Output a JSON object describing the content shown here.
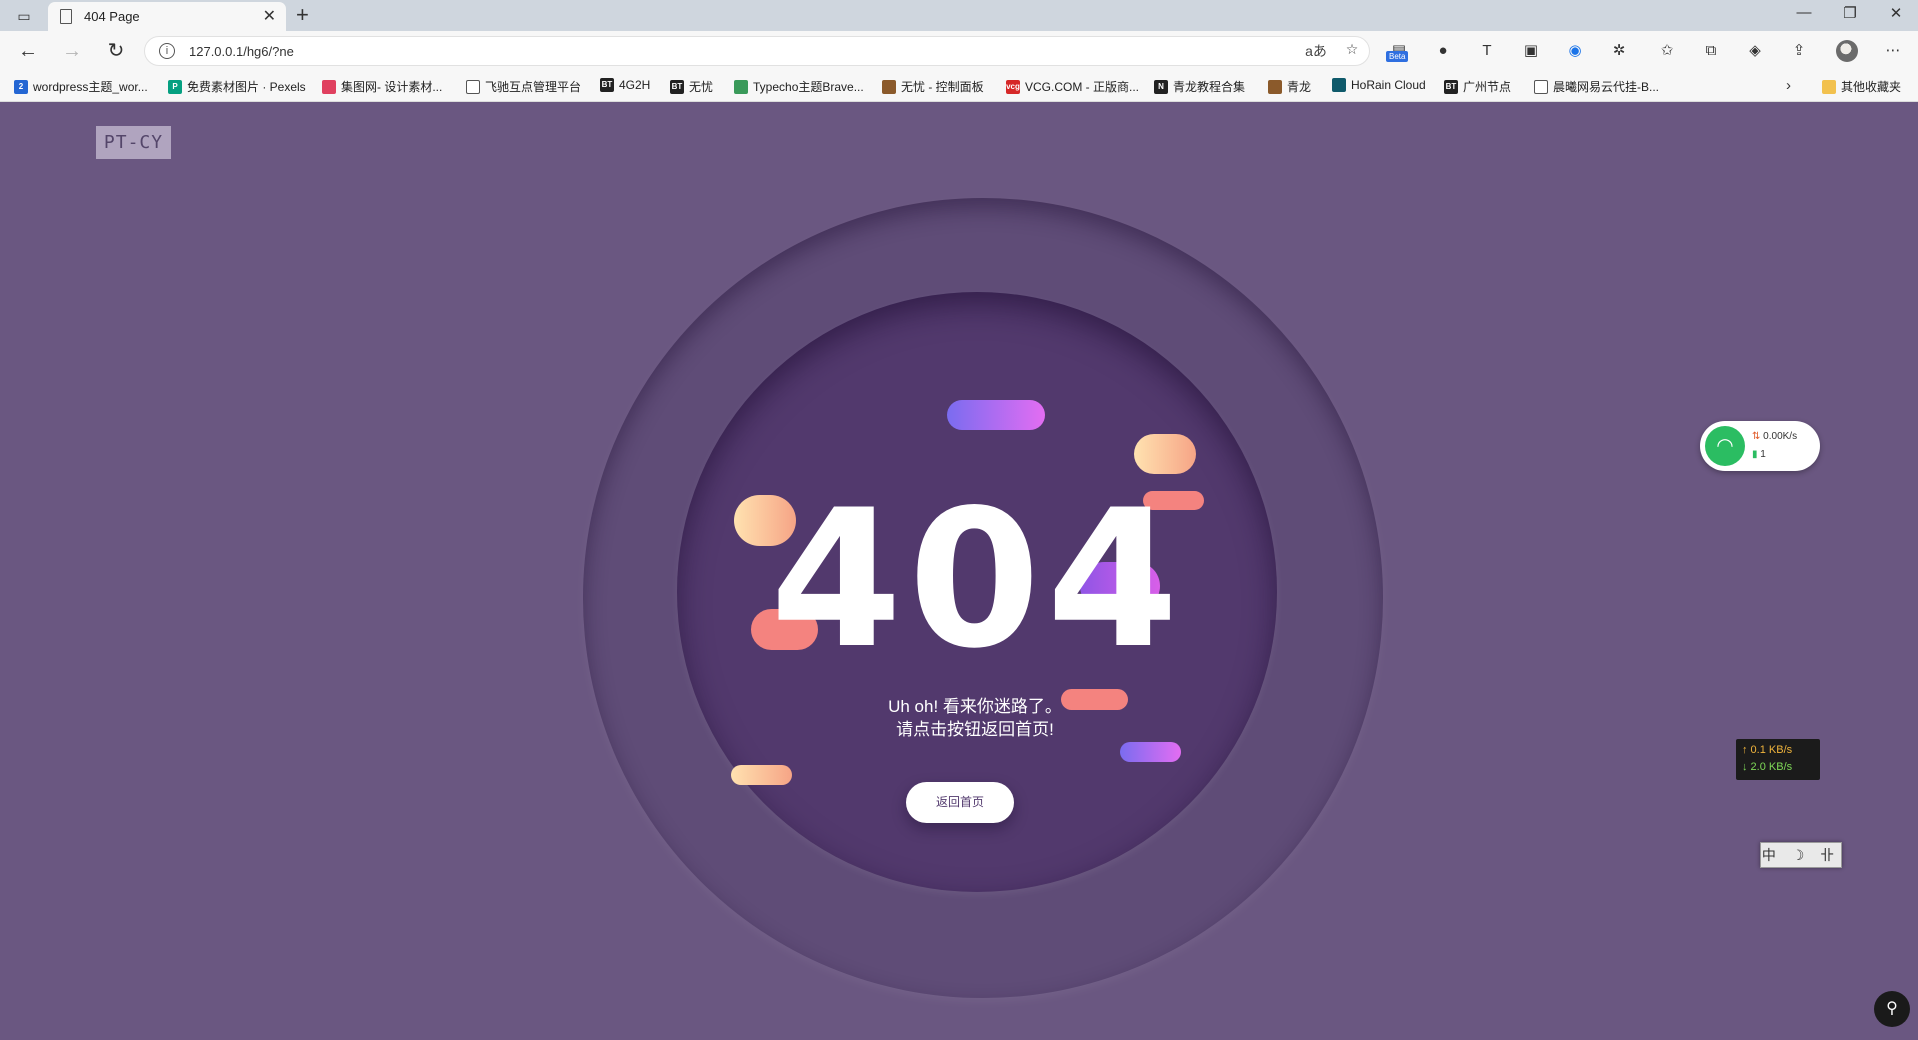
{
  "browser": {
    "tab": {
      "title": "404 Page"
    },
    "address": {
      "url": "127.0.0.1/hg6/?ne"
    },
    "beta_badge": "Beta",
    "bookmarks": [
      {
        "label": "wordpress主题_wor...",
        "icon_color": "#2466d3",
        "icon_text": "2"
      },
      {
        "label": "免费素材图片 · Pexels",
        "icon_color": "#05a081",
        "icon_text": "P"
      },
      {
        "label": "集图网- 设计素材...",
        "icon_color": "#e0405f",
        "icon_text": ""
      },
      {
        "label": "飞驰互点管理平台",
        "icon_color": "#ffffff",
        "icon_text": ""
      },
      {
        "label": "4G2H",
        "icon_color": "#222222",
        "icon_text": "BT"
      },
      {
        "label": "无忧",
        "icon_color": "#222222",
        "icon_text": "BT"
      },
      {
        "label": "Typecho主题Brave...",
        "icon_color": "#3a9a5a",
        "icon_text": ""
      },
      {
        "label": "无忧 - 控制面板",
        "icon_color": "#8b5a2b",
        "icon_text": ""
      },
      {
        "label": "VCG.COM - 正版商...",
        "icon_color": "#d62828",
        "icon_text": "vcg"
      },
      {
        "label": "青龙教程合集",
        "icon_color": "#222222",
        "icon_text": "N"
      },
      {
        "label": "青龙",
        "icon_color": "#8b5a2b",
        "icon_text": ""
      },
      {
        "label": "HoRain Cloud",
        "icon_color": "#0f5a6b",
        "icon_text": ""
      },
      {
        "label": "广州节点",
        "icon_color": "#222222",
        "icon_text": "BT"
      },
      {
        "label": "晨曦网易云代挂-B...",
        "icon_color": "#ffffff",
        "icon_text": ""
      }
    ],
    "other_bookmarks": "其他收藏夹"
  },
  "page": {
    "logo": "PT-CY",
    "error_code": "404",
    "message_line1": "Uh oh! 看来你迷路了。",
    "message_line2": "请点击按钮返回首页!",
    "home_button": "返回首页"
  },
  "widgets": {
    "net_speed": "0.00K/s",
    "net_devices": "1",
    "upload": "↑ 0.1 KB/s",
    "download": "↓ 2.0 KB/s",
    "ime": "中 ☽ 卝"
  }
}
